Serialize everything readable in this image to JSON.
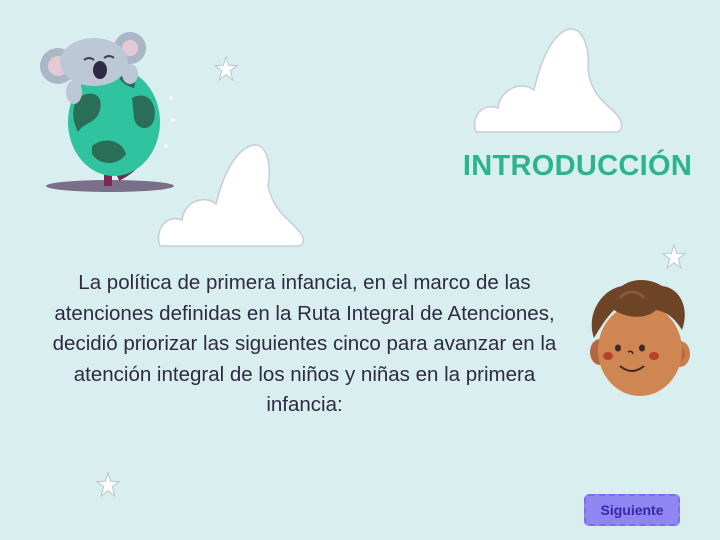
{
  "slide": {
    "title": "INTRODUCCIÓN",
    "body": "La política de primera infancia, en el marco de las atenciones definidas en la Ruta Integral de Atenciones, decidió priorizar las siguientes cinco para avanzar en la atención integral de los niños y niñas en la primera infancia:"
  },
  "navigation": {
    "next_label": "Siguiente"
  },
  "colors": {
    "background": "#d9eeee",
    "title": "#2ab58e",
    "body_text": "#2e2a44",
    "button_fill": "#8f86f2",
    "button_text": "#3b25a8"
  },
  "decorations": {
    "illustrations": [
      "koala-globe-illustration",
      "boy-face-illustration"
    ],
    "icons": [
      "cloud-icon",
      "star-icon"
    ]
  }
}
